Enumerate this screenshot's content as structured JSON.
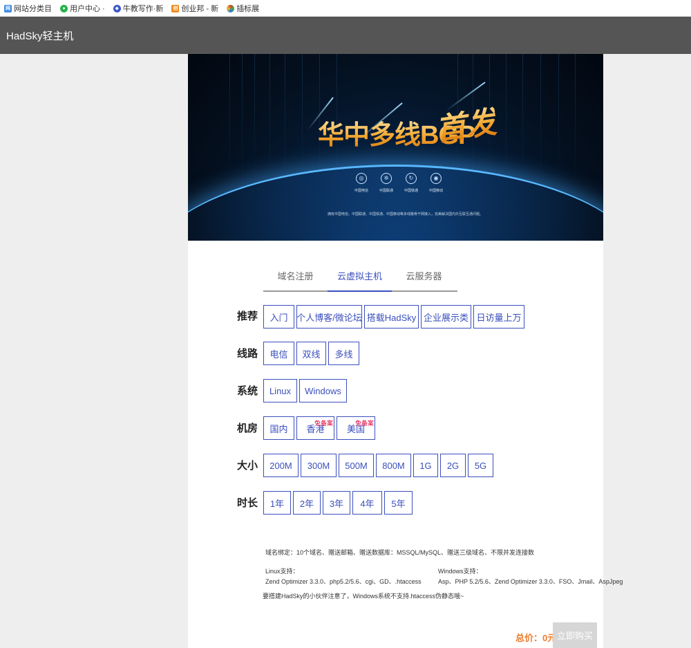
{
  "bookmarks": [
    {
      "label": "网站分类目",
      "icon": "site-directory-icon",
      "color": "#3b8be0"
    },
    {
      "label": "用户中心 ·",
      "icon": "chat-bubble-icon",
      "color": "#26b34a"
    },
    {
      "label": "牛教写作·新",
      "icon": "writing-app-icon",
      "color": "#3a56c9"
    },
    {
      "label": "创业邦 - 新",
      "icon": "cyzone-icon",
      "color": "#f08a1c"
    },
    {
      "label": "插标展",
      "icon": "colorful-circle-icon",
      "color": "#d04a2a"
    }
  ],
  "app": {
    "title": "HadSky轻主机"
  },
  "banner": {
    "headline": "华中多线BGP",
    "script": "首发",
    "carriers": [
      "中国电信",
      "中国联通",
      "中国铁通",
      "中国移动"
    ],
    "subline": "拥有中国电信、中国联通、中国铁通、中国移动等多线路骨干网接入，完美解决国内外互联互通问题。"
  },
  "tabs": [
    {
      "label": "域名注册",
      "active": false
    },
    {
      "label": "云虚拟主机",
      "active": true
    },
    {
      "label": "云服务器",
      "active": false
    }
  ],
  "rows": {
    "recommend": {
      "label": "推荐",
      "options": [
        "入门",
        "个人博客/微论坛",
        "搭载HadSky",
        "企业展示类",
        "日访量上万"
      ]
    },
    "line": {
      "label": "线路",
      "options": [
        "电信",
        "双线",
        "多线"
      ]
    },
    "system": {
      "label": "系统",
      "options": [
        "Linux",
        "Windows"
      ]
    },
    "room": {
      "label": "机房",
      "options": [
        "国内",
        "香港",
        "美国"
      ],
      "tag": "免备案"
    },
    "size": {
      "label": "大小",
      "options": [
        "200M",
        "300M",
        "500M",
        "800M",
        "1G",
        "2G",
        "5G"
      ]
    },
    "duration": {
      "label": "时长",
      "options": [
        "1年",
        "2年",
        "3年",
        "4年",
        "5年"
      ]
    }
  },
  "info": {
    "domain_binding": "域名绑定：10个域名、赠送邮箱、赠送数据库：MSSQL/MySQL、赠送三级域名、不限并发连接数",
    "linux_title": "Linux支持：",
    "linux_detail": "Zend Optimizer 3.3.0、php5.2/5.6、cgi、GD、.htaccess",
    "windows_title": "Windows支持：",
    "windows_detail": "Asp、PHP 5.2/5.6、Zend Optimizer 3.3.0、FSO、Jmail、AspJpeg",
    "notice": "要搭建HadSky的小伙伴注意了，Windows系统不支持.htaccess伪静态哦~"
  },
  "footer": {
    "total": "总价：0元",
    "buy_label": "立即购买"
  },
  "colors": {
    "accent": "#3a4fbd",
    "tag": "#e0003a",
    "total": "#f07b2a",
    "header": "#555555"
  }
}
